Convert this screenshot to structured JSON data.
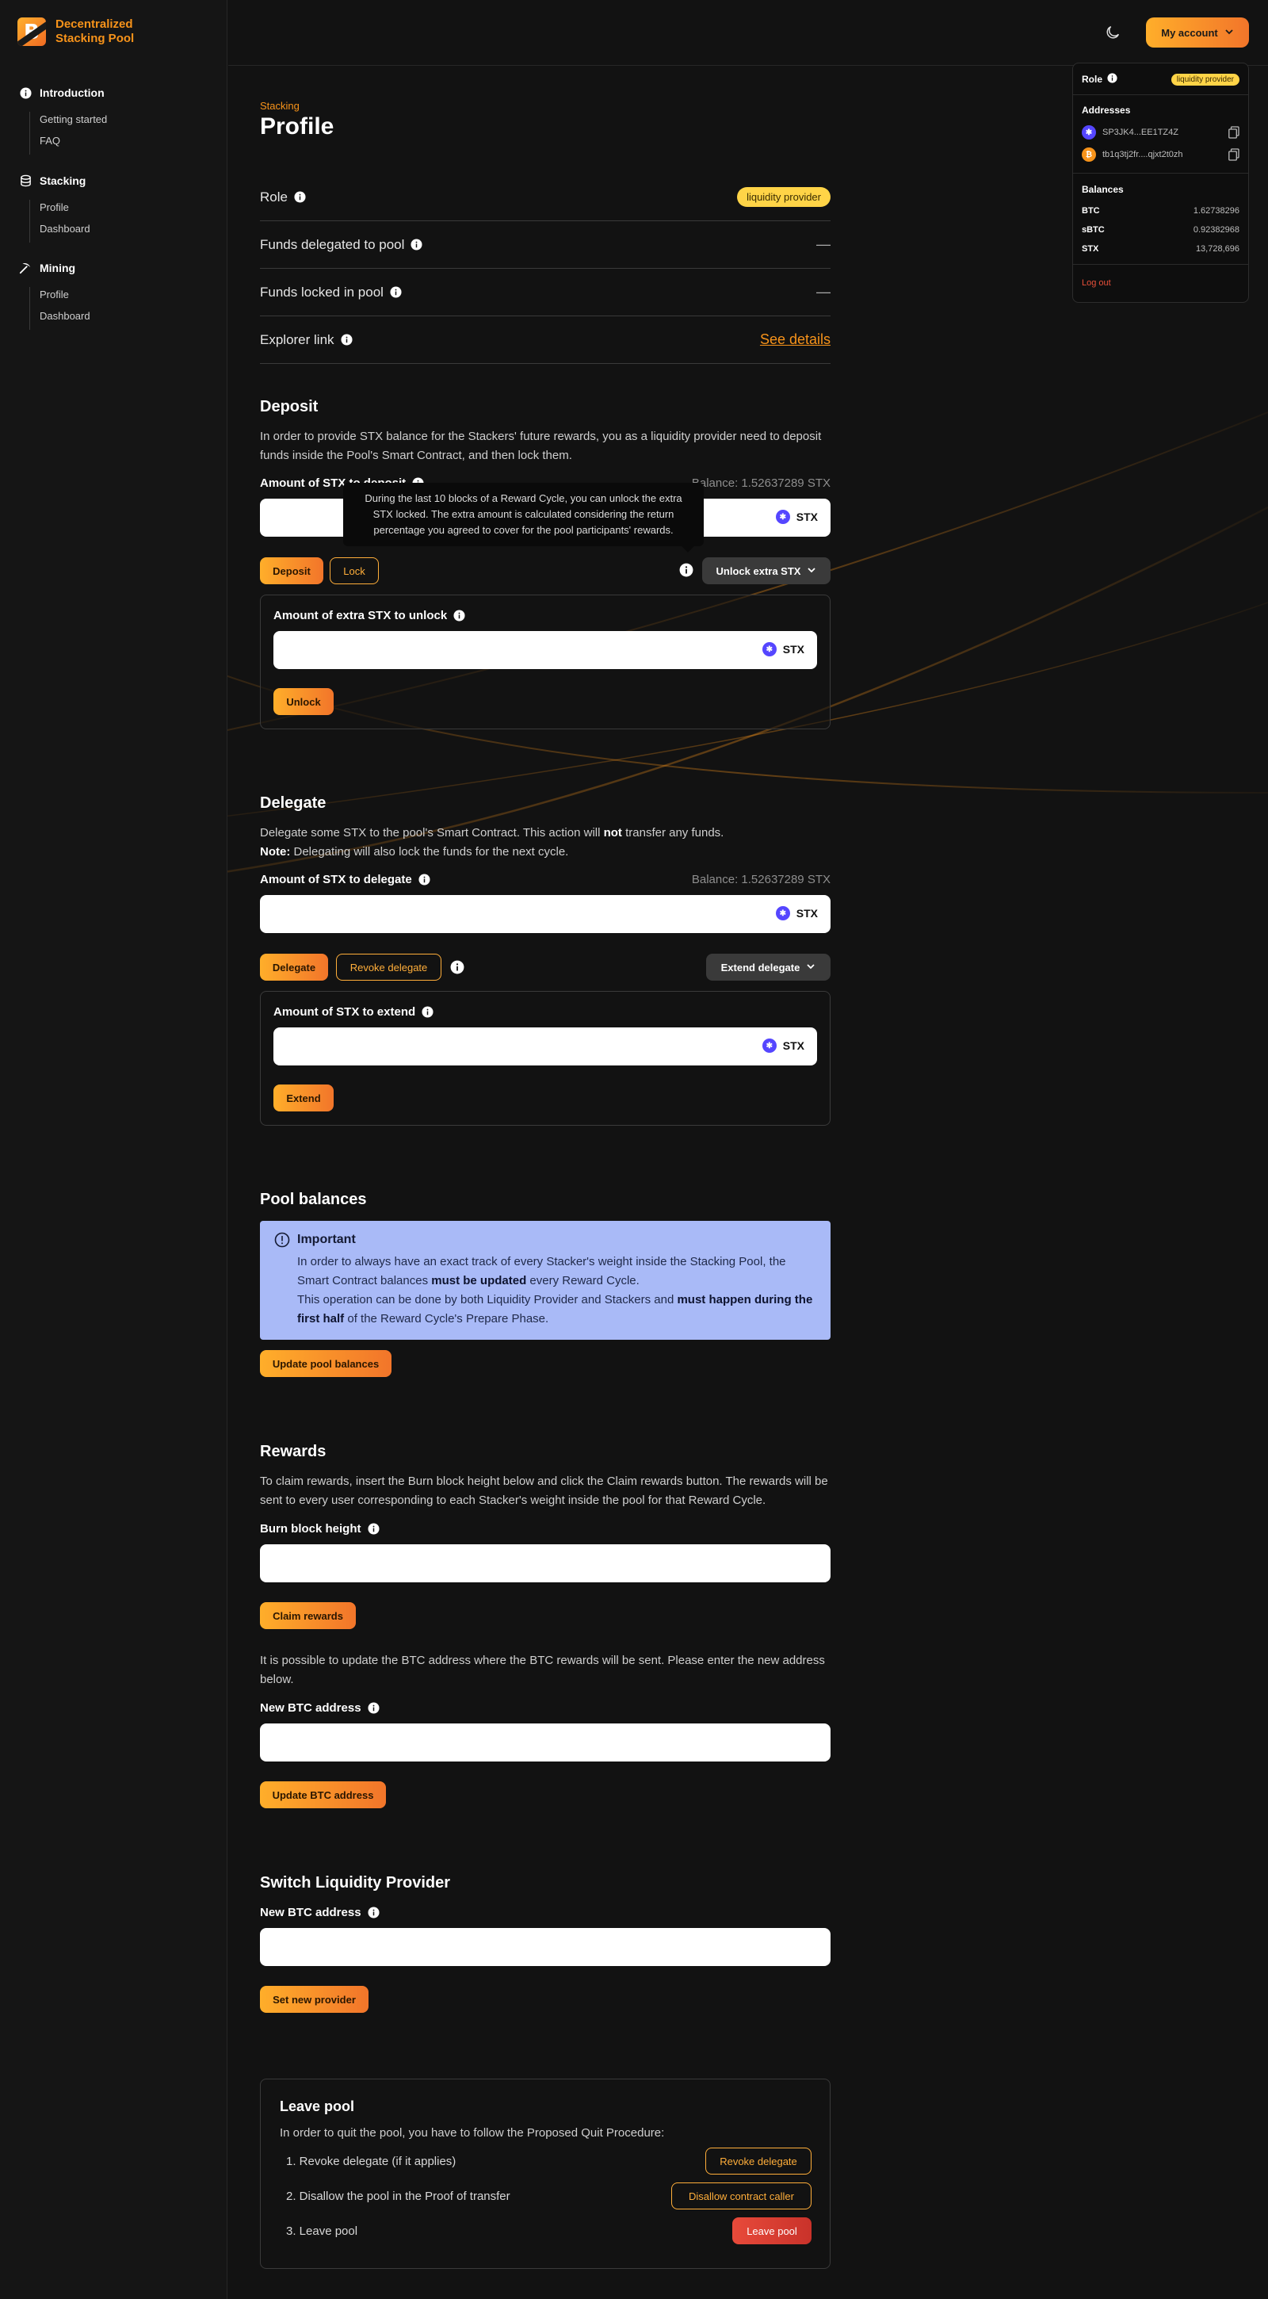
{
  "app": {
    "brand_line1": "Decentralized",
    "brand_line2": "Stacking Pool",
    "logo_letter": "B"
  },
  "sidebar": {
    "sections": [
      {
        "label": "Introduction",
        "icon": "info-circle-icon",
        "items": [
          "Getting started",
          "FAQ"
        ]
      },
      {
        "label": "Stacking",
        "icon": "database-icon",
        "items": [
          "Profile",
          "Dashboard"
        ]
      },
      {
        "label": "Mining",
        "icon": "pickaxe-icon",
        "items": [
          "Profile",
          "Dashboard"
        ]
      }
    ]
  },
  "header": {
    "account_label": "My account",
    "theme_icon": "moon-icon"
  },
  "account_menu": {
    "role_label": "Role",
    "role_value": "liquidity provider",
    "addresses_label": "Addresses",
    "addresses": [
      {
        "coin": "STX",
        "value": "SP3JK4...EE1TZ4Z"
      },
      {
        "coin": "BTC",
        "value": "tb1q3tj2fr....qjxt2t0zh"
      }
    ],
    "balances_label": "Balances",
    "balances": [
      {
        "name": "BTC",
        "value": "1.62738296"
      },
      {
        "name": "sBTC",
        "value": "0.92382968"
      },
      {
        "name": "STX",
        "value": "13,728,696"
      }
    ],
    "logout_label": "Log out"
  },
  "page": {
    "breadcrumb": "Stacking",
    "title": "Profile"
  },
  "profile_rows": {
    "role_label": "Role",
    "role_value": "liquidity provider",
    "delegated_label": "Funds delegated to pool",
    "delegated_value": "—",
    "locked_label": "Funds locked in pool",
    "locked_value": "—",
    "explorer_label": "Explorer link",
    "explorer_value": "See details"
  },
  "deposit": {
    "title": "Deposit",
    "description": "In order to provide STX balance for the Stackers' future rewards, you as a liquidity provider need to deposit funds inside the Pool's Smart Contract, and then lock them.",
    "amount_label": "Amount of STX to deposit",
    "balance": "Balance: 1.52637289 STX",
    "currency": "STX",
    "deposit_button": "Deposit",
    "lock_button": "Lock",
    "unlock_extra_button": "Unlock extra STX",
    "tooltip": "During the last 10 blocks of a Reward Cycle, you can unlock the extra STX locked. The extra amount is calculated considering the return percentage you agreed to cover for the pool participants' rewards.",
    "extra_label": "Amount of extra STX to unlock",
    "unlock_button": "Unlock"
  },
  "delegate": {
    "title": "Delegate",
    "desc_part1": "Delegate some STX to the pool's Smart Contract. This action will ",
    "desc_bold": "not",
    "desc_part2": " transfer any funds.",
    "note_bold": "Note:",
    "note_text": " Delegating will also lock the funds for the next cycle.",
    "amount_label": "Amount of STX to delegate",
    "balance": "Balance: 1.52637289 STX",
    "currency": "STX",
    "delegate_button": "Delegate",
    "revoke_button": "Revoke delegate",
    "extend_menu_button": "Extend delegate",
    "extend_label": "Amount of STX to extend",
    "extend_button": "Extend"
  },
  "pool_balances": {
    "title": "Pool balances",
    "important_title": "Important",
    "text1": "In order to always have an exact track of every Stacker's weight inside the Stacking Pool, the Smart Contract balances ",
    "text1_bold": "must be updated",
    "text1_end": " every Reward Cycle.",
    "text2": "This operation can be done by both Liquidity Provider and Stackers and ",
    "text2_bold": "must happen during the first half",
    "text2_end": " of the Reward Cycle's Prepare Phase.",
    "update_button": "Update pool balances"
  },
  "rewards": {
    "title": "Rewards",
    "description": "To claim rewards, insert the Burn block height below and click the Claim rewards button. The rewards will be sent to every user corresponding to each Stacker's weight inside the pool for that Reward Cycle.",
    "burn_label": "Burn block height",
    "claim_button": "Claim rewards",
    "btc_description": "It is possible to update the BTC address where the BTC rewards will be sent. Please enter the new address below.",
    "btc_label": "New BTC address",
    "update_btc_button": "Update BTC address"
  },
  "switch_provider": {
    "title": "Switch Liquidity Provider",
    "btc_label": "New BTC address",
    "set_button": "Set new provider"
  },
  "leave_pool": {
    "title": "Leave pool",
    "description": "In order to quit the pool, you have to follow the Proposed Quit Procedure:",
    "steps": [
      {
        "text": "1. Revoke delegate (if it applies)",
        "button": "Revoke delegate"
      },
      {
        "text": "2. Disallow the pool in the Proof of transfer",
        "button": "Disallow contract caller"
      },
      {
        "text": "3. Leave pool",
        "button": "Leave pool"
      }
    ]
  },
  "colors": {
    "accent": "#f7931a",
    "background": "#121212",
    "badge": "#ffd447",
    "important_bg": "#a9baf7",
    "danger": "#d83c2e"
  }
}
